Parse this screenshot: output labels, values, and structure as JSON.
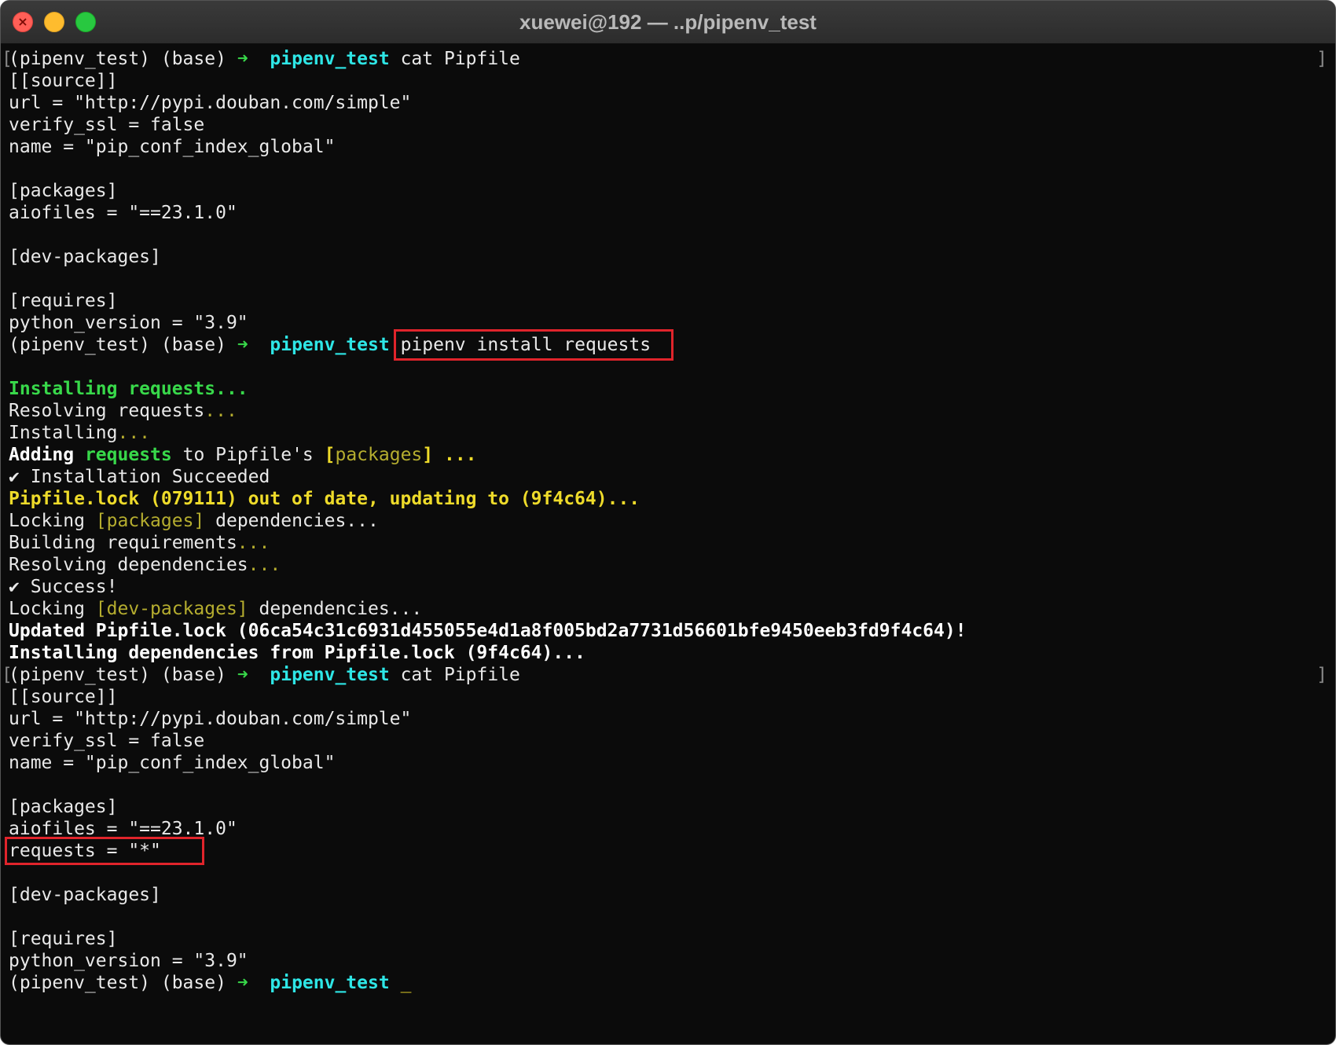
{
  "window": {
    "title": "xuewei@192 — ..p/pipenv_test"
  },
  "prompt": {
    "env": "(pipenv_test) (base)",
    "arrow": "➜",
    "dir": "pipenv_test"
  },
  "commands": {
    "cat_pipfile": "cat Pipfile",
    "install": "pipenv install requests"
  },
  "pipfile_before": {
    "source_header": "[[source]]",
    "url": "url = \"http://pypi.douban.com/simple\"",
    "verify_ssl": "verify_ssl = false",
    "name": "name = \"pip_conf_index_global\"",
    "packages_header": "[packages]",
    "aiofiles": "aiofiles = \"==23.1.0\"",
    "dev_header": "[dev-packages]",
    "requires_header": "[requires]",
    "python_version": "python_version = \"3.9\""
  },
  "install_output": {
    "installing": "Installing requests...",
    "resolving_word": "Resolving requests",
    "dots": "...",
    "installing_word": "Installing",
    "adding_word": "Adding",
    "adding_pkg": "requests",
    "adding_mid": "to Pipfile's",
    "adding_section": "[packages]",
    "adding_end": "...",
    "succeeded": "✔ Installation Succeeded",
    "lock_outdated": "Pipfile.lock (079111) out of date, updating to (9f4c64)...",
    "locking_word": "Locking",
    "locking_packages_section": "[packages]",
    "locking_deps": "dependencies...",
    "building": "Building requirements",
    "resolving_deps": "Resolving dependencies",
    "success": "✔ Success!",
    "locking_dev_section": "[dev-packages]",
    "updated_lock": "Updated Pipfile.lock (06ca54c31c6931d455055e4d1a8f005bd2a7731d56601bfe9450eeb3fd9f4c64)!",
    "installing_deps": "Installing dependencies from Pipfile.lock (9f4c64)..."
  },
  "pipfile_after": {
    "source_header": "[[source]]",
    "url": "url = \"http://pypi.douban.com/simple\"",
    "verify_ssl": "verify_ssl = false",
    "name": "name = \"pip_conf_index_global\"",
    "packages_header": "[packages]",
    "aiofiles": "aiofiles = \"==23.1.0\"",
    "requests": "requests = \"*\"",
    "dev_header": "[dev-packages]",
    "requires_header": "[requires]",
    "python_version": "python_version = \"3.9\""
  },
  "cursor": "_",
  "colors": {
    "highlight_box": "#e0242b",
    "prompt_dir": "#2ee6e6",
    "prompt_arrow": "#38d84a",
    "warning_yellow": "#eedb2a",
    "background": "#0b0b0b"
  }
}
